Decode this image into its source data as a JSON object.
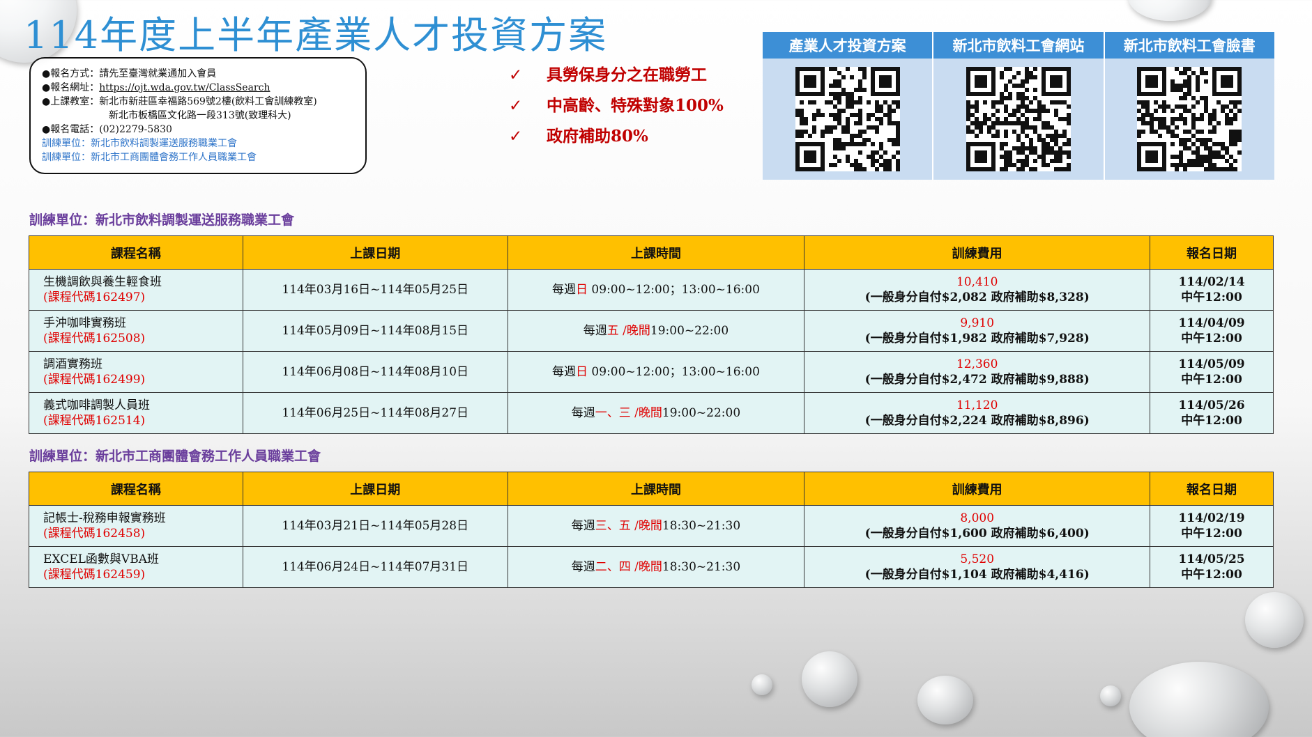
{
  "title": "114年度上半年產業人才投資方案",
  "info": {
    "l1_label": "●報名方式：",
    "l1_value": "請先至臺灣就業通加入會員",
    "l2_label": "●報名網址：",
    "l2_value": "https://ojt.wda.gov.tw/ClassSearch",
    "l3_label": "●上課教室：",
    "l3_value": "新北市新莊區幸福路569號2樓(飲料工會訓練教室)",
    "l4_value": "新北市板橋區文化路一段313號(致理科大)",
    "l5_label": "●報名電話：",
    "l5_value": "(02)2279-5830",
    "l6": "訓練單位：新北市飲料調製運送服務職業工會",
    "l7": "訓練單位：新北市工商團體會務工作人員職業工會"
  },
  "bullets": [
    "具勞保身分之在職勞工",
    "中高齡、特殊對象100%",
    "政府補助80%"
  ],
  "check_mark": "✓",
  "qr_headers": [
    "產業人才投資方案",
    "新北市飲料工會網站",
    "新北市飲料工會臉書"
  ],
  "section1_label": "訓練單位：新北市飲料調製運送服務職業工會",
  "section2_label": "訓練單位：新北市工商團體會務工作人員職業工會",
  "table_headers": [
    "課程名稱",
    "上課日期",
    "上課時間",
    "訓練費用",
    "報名日期"
  ],
  "table1_rows": [
    {
      "name": "生機調飲與養生輕食班",
      "code": "(課程代碼162497)",
      "dates": "114年03月16日~114年05月25日",
      "t_pre": "每週",
      "t_day": "日",
      "t_post": " 09:00~12:00；13:00~16:00",
      "fee": "10,410",
      "fee_detail": "(一般身分自付$2,082 政府補助$8,328)",
      "reg_date": "114/02/14",
      "reg_time": "中午12:00"
    },
    {
      "name": "手沖咖啡實務班",
      "code": "(課程代碼162508)",
      "dates": "114年05月09日~114年08月15日",
      "t_pre": "每週",
      "t_day": "五 /晚間",
      "t_post": "19:00~22:00",
      "fee": "9,910",
      "fee_detail": "(一般身分自付$1,982 政府補助$7,928)",
      "reg_date": "114/04/09",
      "reg_time": "中午12:00"
    },
    {
      "name": "調酒實務班",
      "code": "(課程代碼162499)",
      "dates": "114年06月08日~114年08月10日",
      "t_pre": "每週",
      "t_day": "日",
      "t_post": " 09:00~12:00；13:00~16:00",
      "fee": "12,360",
      "fee_detail": "(一般身分自付$2,472 政府補助$9,888)",
      "reg_date": "114/05/09",
      "reg_time": "中午12:00"
    },
    {
      "name": "義式咖啡調製人員班",
      "code": "(課程代碼162514)",
      "dates": "114年06月25日~114年08月27日",
      "t_pre": "每週",
      "t_day": "一、三 /晚間",
      "t_post": "19:00~22:00",
      "fee": "11,120",
      "fee_detail": "(一般身分自付$2,224 政府補助$8,896)",
      "reg_date": "114/05/26",
      "reg_time": "中午12:00"
    }
  ],
  "table2_rows": [
    {
      "name": "記帳士-稅務申報實務班",
      "code": "(課程代碼162458)",
      "dates": "114年03月21日~114年05月28日",
      "t_pre": "每週",
      "t_day": "三、五 /晚間",
      "t_post": "18:30~21:30",
      "fee": "8,000",
      "fee_detail": "(一般身分自付$1,600 政府補助$6,400)",
      "reg_date": "114/02/19",
      "reg_time": "中午12:00"
    },
    {
      "name": "EXCEL函數與VBA班",
      "code": "(課程代碼162459)",
      "dates": "114年06月24日~114年07月31日",
      "t_pre": "每週",
      "t_day": "二、四 /晚間",
      "t_post": "18:30~21:30",
      "fee": "5,520",
      "fee_detail": "(一般身分自付$1,104 政府補助$4,416)",
      "reg_date": "114/05/25",
      "reg_time": "中午12:00"
    }
  ]
}
